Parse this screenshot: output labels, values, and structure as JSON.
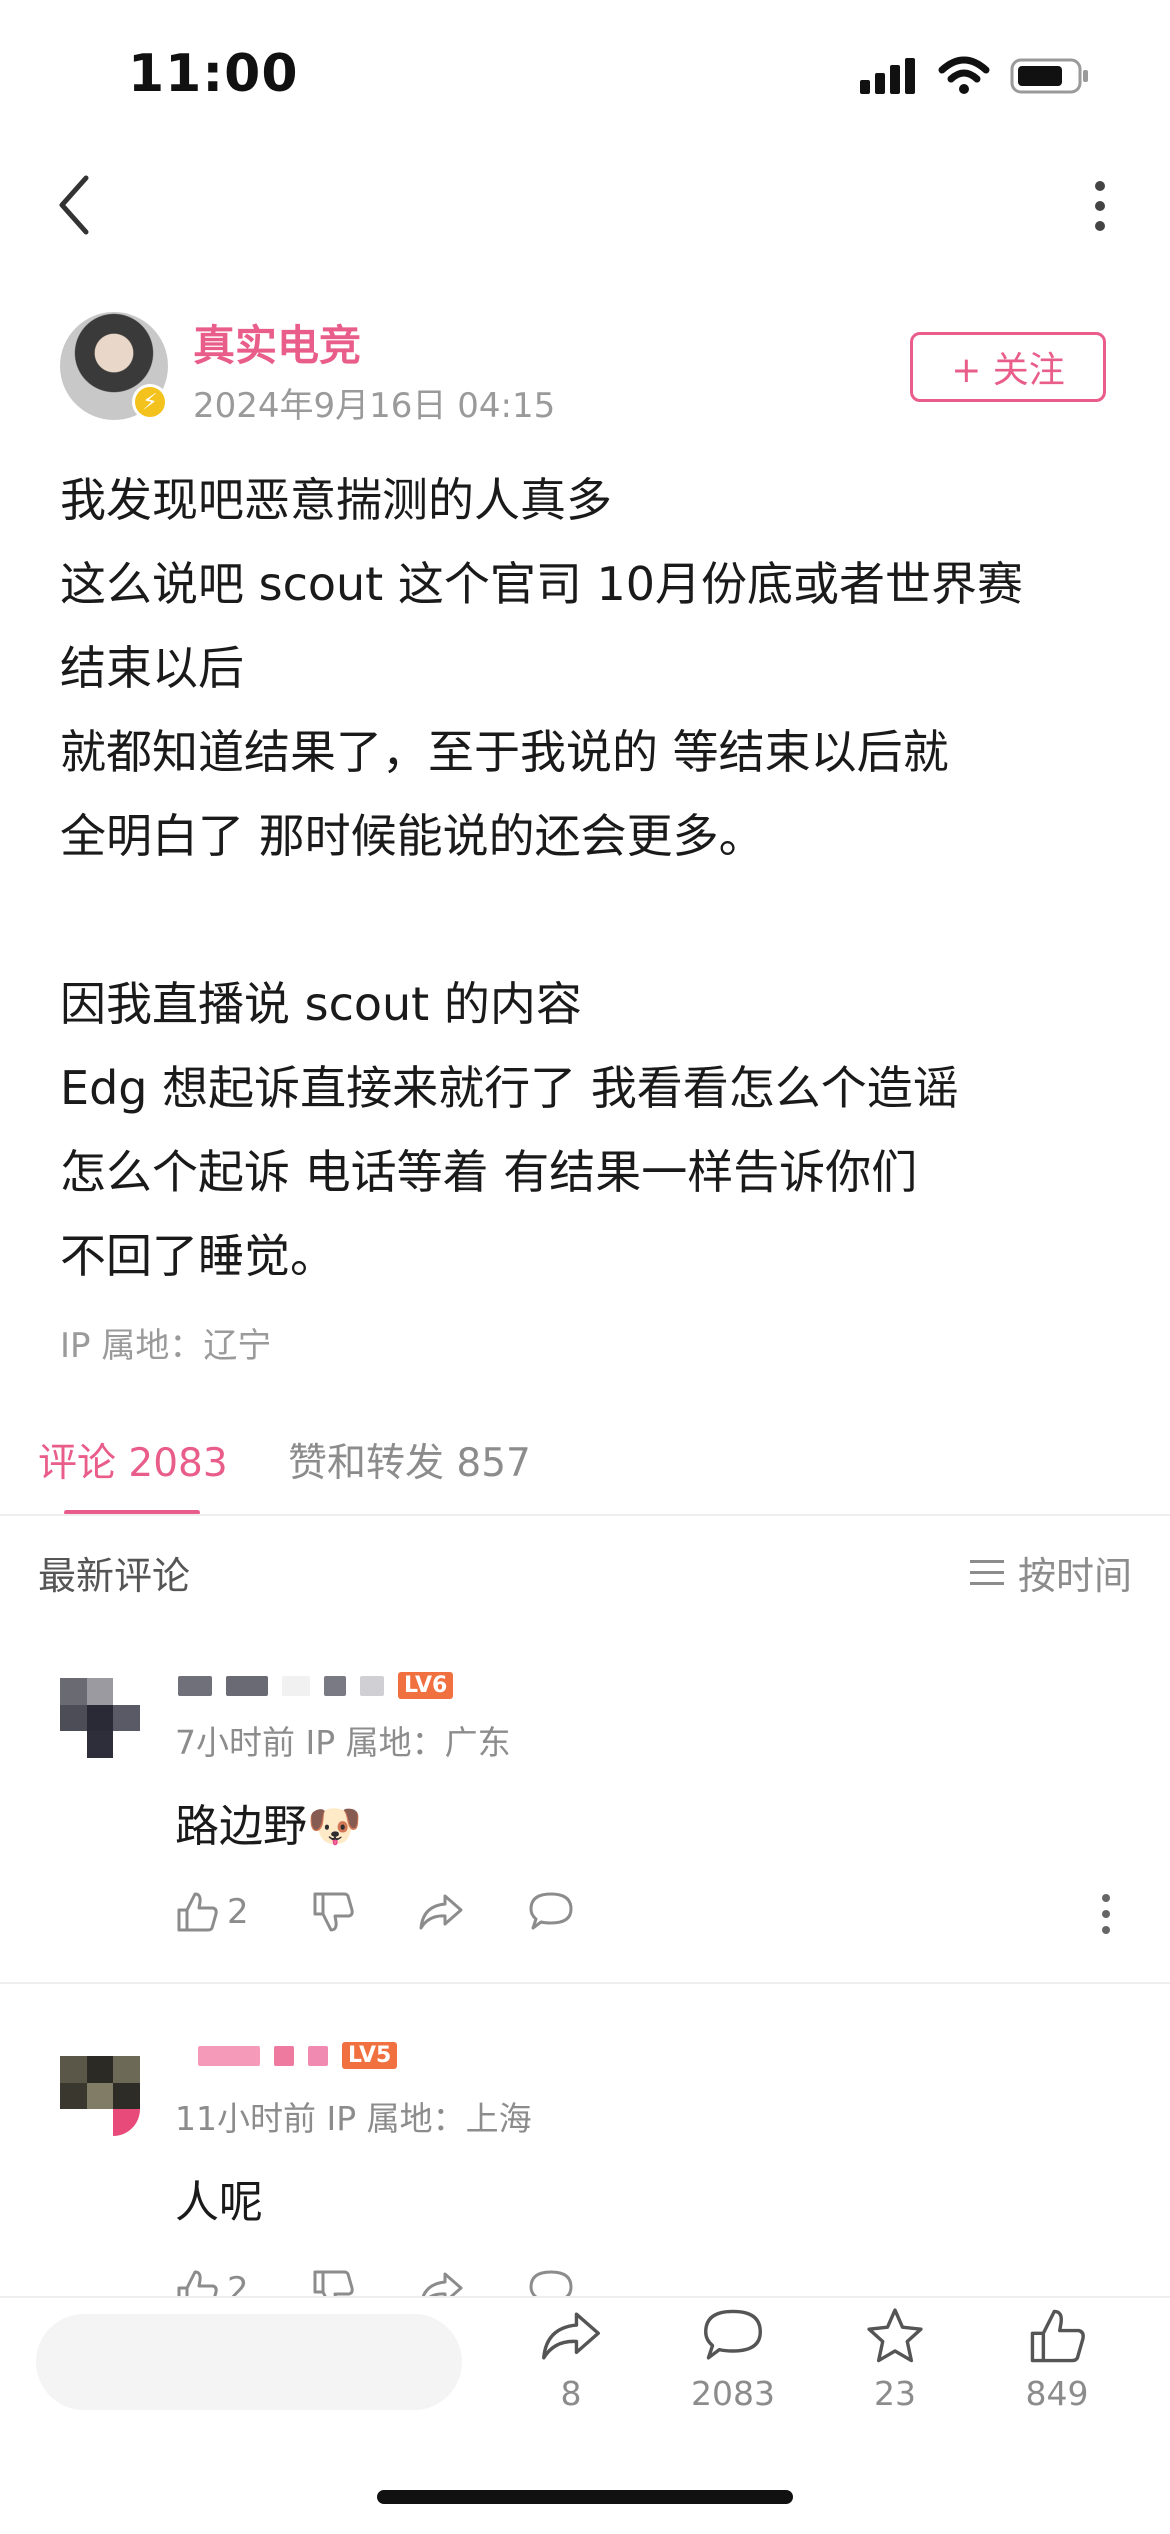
{
  "status_bar": {
    "time": "11:00"
  },
  "author": {
    "name": "真实电竞",
    "time": "2024年9月16日 04:15",
    "follow_label": "+ 关注"
  },
  "post": {
    "lines": [
      "我发现吧恶意揣测的人真多",
      "这么说吧 scout 这个官司 10月份底或者世界赛",
      "结束以后",
      "就都知道结果了，至于我说的 等结束以后就",
      "全明白了 那时候能说的还会更多。",
      "",
      "因我直播说 scout 的内容",
      "Edg 想起诉直接来就行了  我看看怎么个造谣",
      "怎么个起诉 电话等着 有结果一样告诉你们",
      "不回了睡觉。"
    ],
    "ip": "IP 属地：辽宁"
  },
  "tabs": {
    "comments": "评论 2083",
    "likes_shares": "赞和转发 857"
  },
  "sort": {
    "title": "最新评论",
    "by_time": "按时间"
  },
  "comments": [
    {
      "level_badge": "LV6",
      "meta": "7小时前  IP 属地：广东",
      "text": "路边野🐶",
      "likes": "2"
    },
    {
      "level_badge": "LV5",
      "meta": "11小时前  IP 属地：上海",
      "text": "人呢",
      "likes": "2"
    }
  ],
  "bottom_bar": {
    "shares": "8",
    "comments": "2083",
    "favorites": "23",
    "likes": "849"
  },
  "colors": {
    "accent": "#e95d8a",
    "muted": "#8c8c8c"
  }
}
